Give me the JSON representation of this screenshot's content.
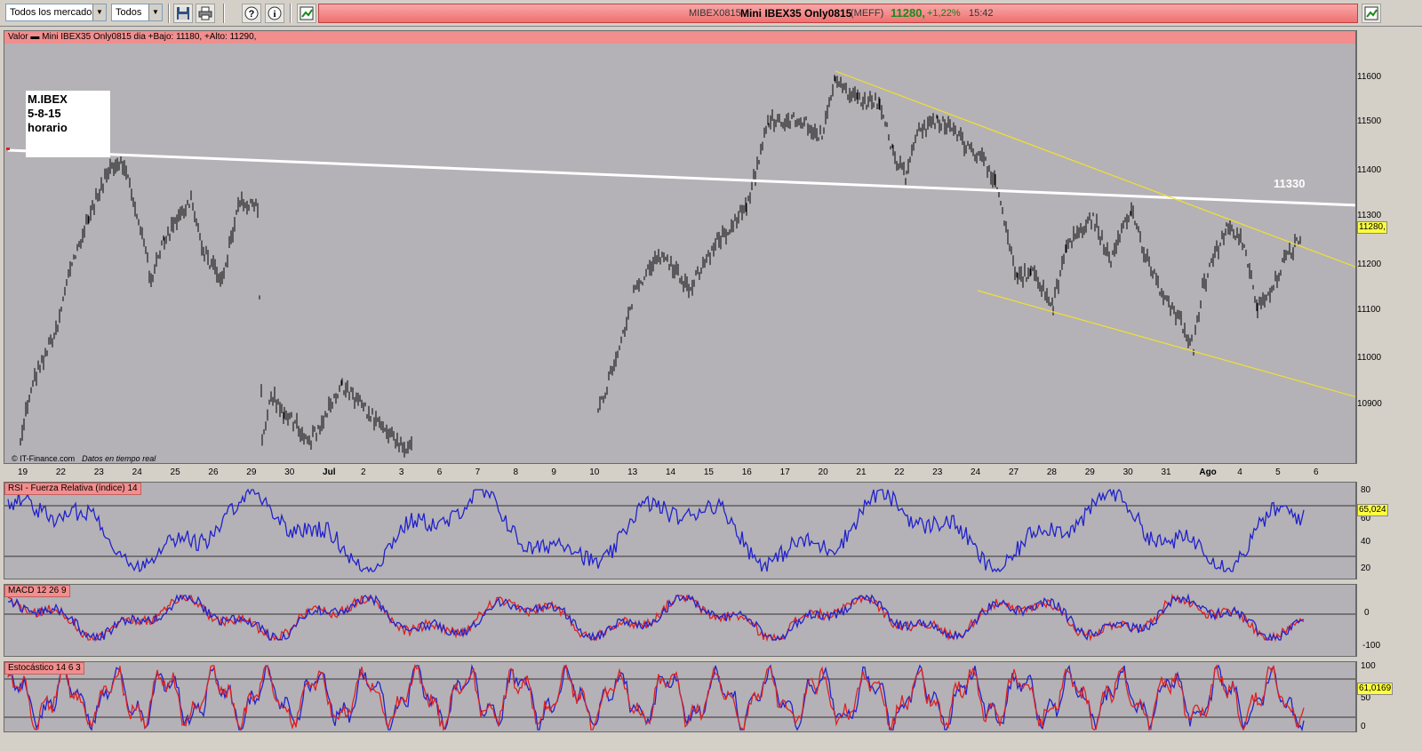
{
  "toolbar": {
    "market_select": "Todos los mercados",
    "filter_select": "Todos",
    "save_icon": "save-icon",
    "print_icon": "print-icon",
    "help_icon": "help-icon",
    "info_icon": "info-icon"
  },
  "quote": {
    "symbol": "MIBEX0815",
    "name": "Mini IBEX35 Only0815",
    "market": "(MEFF)",
    "price": "11280,",
    "change": "+1,22%",
    "time": "15:42"
  },
  "main_panel": {
    "header": "Valor    ▬ Mini IBEX35 Only0815    dia +Bajo: 11180, +Alto: 11290,",
    "note": [
      "M.IBEX",
      "5-8-15",
      "horario"
    ],
    "level_label": "11330",
    "source": "© IT-Finance.com",
    "source_note": "Datos en tiempo real",
    "y_ticks": [
      "11600",
      "11500",
      "11400",
      "11300",
      "11200",
      "11100",
      "11000",
      "10900"
    ],
    "last_badge": "11280,"
  },
  "x_axis": {
    "labels": [
      "19",
      "22",
      "23",
      "24",
      "25",
      "26",
      "29",
      "30",
      "Jul",
      "2",
      "3",
      "6",
      "7",
      "8",
      "9",
      "10",
      "13",
      "14",
      "15",
      "16",
      "17",
      "20",
      "21",
      "22",
      "23",
      "24",
      "27",
      "28",
      "29",
      "30",
      "31",
      "Ago",
      "4",
      "5",
      "6"
    ]
  },
  "rsi_panel": {
    "title": "RSI - Fuerza Relativa (índice) 14",
    "y_ticks": [
      "80",
      "60",
      "40",
      "20"
    ],
    "last_badge": "65,024"
  },
  "macd_panel": {
    "title": "MACD 12 26 9",
    "y_ticks": [
      "0",
      "-100"
    ]
  },
  "stoch_panel": {
    "title": "Estocástico 14 6 3",
    "y_ticks": [
      "100",
      "50",
      "0"
    ],
    "last_badge": "61,0169"
  },
  "colors": {
    "panel_bg": "#b4b2b6",
    "header_bg": "#f28e8e",
    "trend_resistance": "#ffffff",
    "channel_lines": "#f0e030",
    "rsi_line": "#2222cc",
    "macd_line": "#2222cc",
    "signal_line": "#dd2222",
    "price_up": "#1a8a1a"
  }
}
